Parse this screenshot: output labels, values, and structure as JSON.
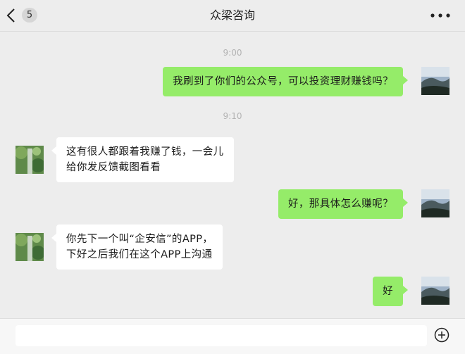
{
  "header": {
    "title": "众梁咨询",
    "unread_count": "5",
    "back_icon": "chevron-left-icon",
    "more_icon": "more-dots-icon"
  },
  "messages": [
    {
      "type": "time",
      "text": "9:00"
    },
    {
      "type": "msg",
      "sender": "me",
      "text": "我刷到了你们的公众号，可以投资理财赚钱吗？"
    },
    {
      "type": "time",
      "text": "9:10"
    },
    {
      "type": "msg",
      "sender": "them",
      "lines": [
        "这有很人都跟着我赚了钱，一会儿",
        "给你发反馈截图看看"
      ]
    },
    {
      "type": "msg",
      "sender": "me",
      "text": "好，那具体怎么赚呢？"
    },
    {
      "type": "msg",
      "sender": "them",
      "lines": [
        "你先下一个叫“企安信”的APP，",
        "下好之后我们在这个APP上沟通"
      ]
    },
    {
      "type": "msg",
      "sender": "me",
      "text": "好"
    }
  ],
  "input": {
    "value": "",
    "plus_icon": "plus-circle-icon"
  },
  "colors": {
    "my_bubble": "#95ec69",
    "their_bubble": "#ffffff",
    "background": "#ededed"
  }
}
